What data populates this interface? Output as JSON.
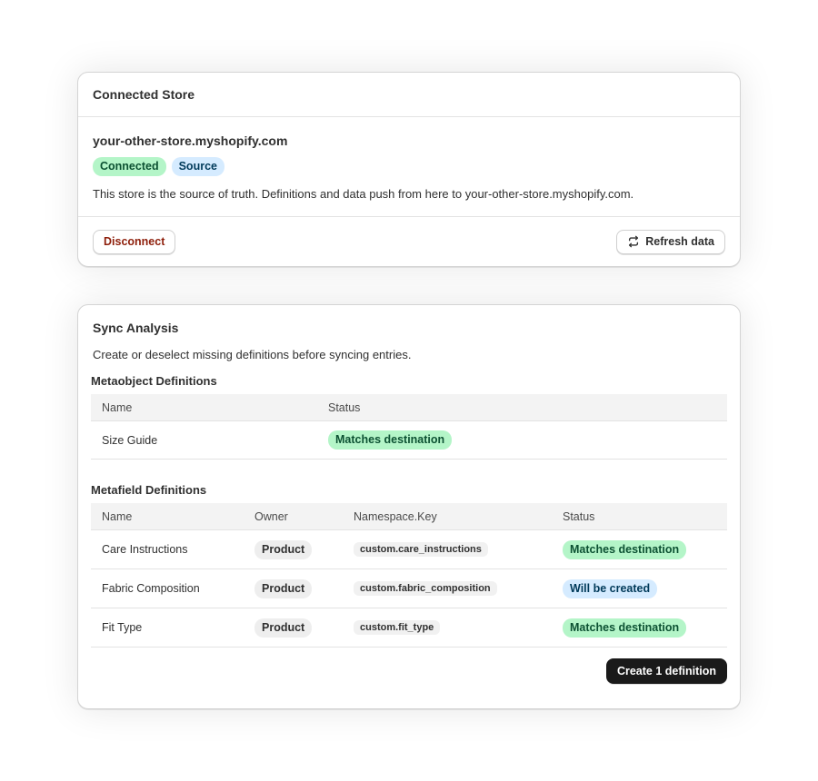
{
  "connected_store": {
    "title": "Connected Store",
    "domain": "your-other-store.myshopify.com",
    "badges": [
      "Connected",
      "Source"
    ],
    "description": "This store is the source of truth. Definitions and data push from here to your-other-store.myshopify.com.",
    "disconnect_label": "Disconnect",
    "refresh_label": "Refresh data",
    "refresh_icon": "refresh-icon"
  },
  "sync_analysis": {
    "title": "Sync Analysis",
    "subtitle": "Create or deselect missing definitions before syncing entries.",
    "metaobject": {
      "title": "Metaobject Definitions",
      "columns": [
        "Name",
        "Status"
      ],
      "rows": [
        {
          "name": "Size Guide",
          "status": "Matches destination",
          "status_type": "match"
        }
      ]
    },
    "metafield": {
      "title": "Metafield Definitions",
      "columns": [
        "Name",
        "Owner",
        "Namespace.Key",
        "Status"
      ],
      "rows": [
        {
          "name": "Care Instructions",
          "owner": "Product",
          "key": "custom.care_instructions",
          "status": "Matches destination",
          "status_type": "match"
        },
        {
          "name": "Fabric Composition",
          "owner": "Product",
          "key": "custom.fabric_composition",
          "status": "Will be created",
          "status_type": "create"
        },
        {
          "name": "Fit Type",
          "owner": "Product",
          "key": "custom.fit_type",
          "status": "Matches destination",
          "status_type": "match"
        }
      ]
    },
    "create_label": "Create 1 definition"
  },
  "colors": {
    "match_bg": "#b4f5c8",
    "create_bg": "#d5ebff",
    "primary_button": "#1a1a1a",
    "danger_text": "#8e1f0b"
  }
}
